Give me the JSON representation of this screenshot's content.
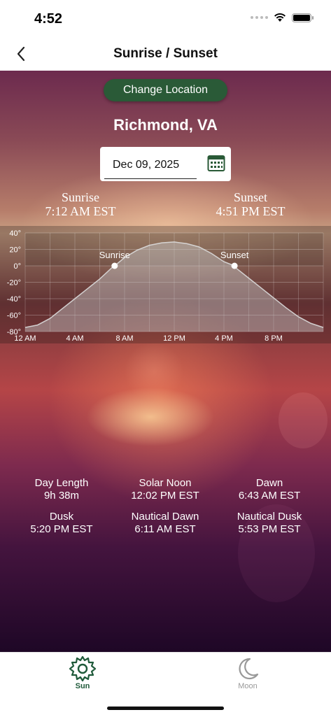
{
  "status_bar": {
    "time": "4:52"
  },
  "navbar": {
    "title": "Sunrise / Sunset"
  },
  "main": {
    "change_location_label": "Change Location",
    "city": "Richmond, VA",
    "date_value": "Dec 09, 2025",
    "sunrise": {
      "label": "Sunrise",
      "time": "7:12 AM EST"
    },
    "sunset": {
      "label": "Sunset",
      "time": "4:51 PM EST"
    }
  },
  "chart_data": {
    "type": "area",
    "title": "",
    "xlabel": "",
    "ylabel": "",
    "x_ticks": [
      "12 AM",
      "4 AM",
      "8 AM",
      "12 PM",
      "4 PM",
      "8 PM"
    ],
    "y_ticks": [
      "40°",
      "20°",
      "0°",
      "-20°",
      "-40°",
      "-60°",
      "-80°"
    ],
    "ylim": [
      -80,
      40
    ],
    "xlim": [
      0,
      24
    ],
    "series": [
      {
        "name": "",
        "x": [
          0,
          1,
          2,
          3,
          4,
          5,
          6,
          7,
          7.2,
          8,
          9,
          10,
          11,
          12,
          13,
          14,
          15,
          16,
          16.85,
          17,
          18,
          19,
          20,
          21,
          22,
          23,
          24
        ],
        "values": [
          -75,
          -72,
          -64,
          -52,
          -40,
          -28,
          -16,
          -2,
          0,
          10,
          19,
          25,
          28,
          29,
          27,
          23,
          15,
          5,
          0,
          -3,
          -15,
          -27,
          -39,
          -51,
          -62,
          -70,
          -75
        ]
      }
    ],
    "annotations": [
      {
        "label": "Sunrise",
        "x": 7.2,
        "y": 0
      },
      {
        "label": "Sunset",
        "x": 16.85,
        "y": 0
      }
    ],
    "grid": true
  },
  "info": [
    {
      "label": "Day Length",
      "value": "9h 38m"
    },
    {
      "label": "Solar Noon",
      "value": "12:02 PM EST"
    },
    {
      "label": "Dawn",
      "value": "6:43 AM EST"
    },
    {
      "label": "Dusk",
      "value": "5:20 PM EST"
    },
    {
      "label": "Nautical Dawn",
      "value": "6:11 AM EST"
    },
    {
      "label": "Nautical Dusk",
      "value": "5:53 PM EST"
    }
  ],
  "tabs": [
    {
      "label": "Sun",
      "icon": "sun-icon",
      "active": true
    },
    {
      "label": "Moon",
      "icon": "moon-icon",
      "active": false
    }
  ]
}
